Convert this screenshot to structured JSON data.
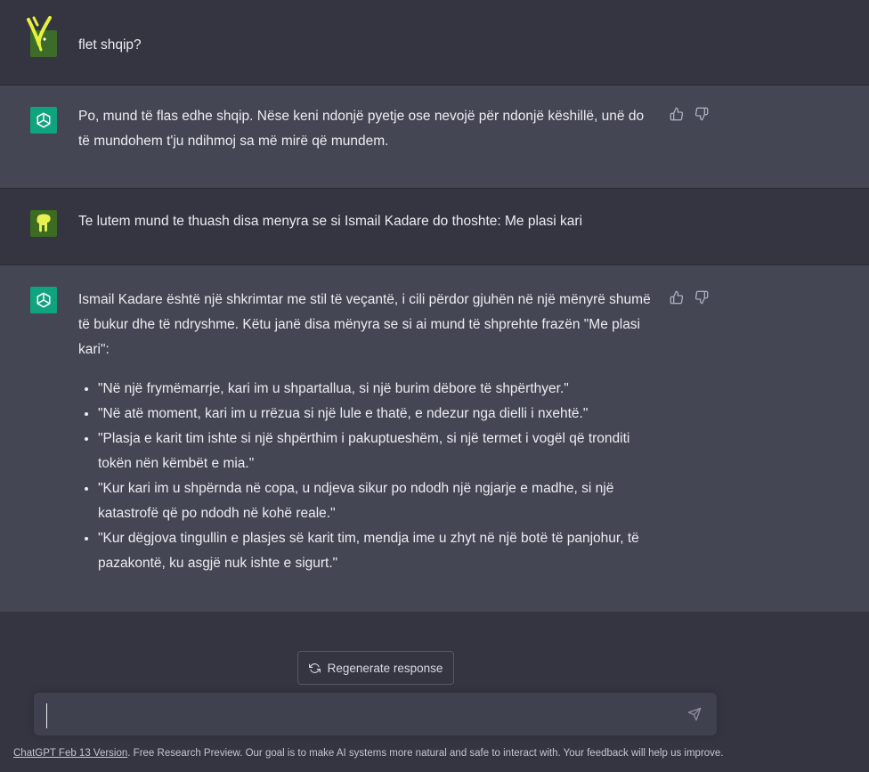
{
  "conversation": {
    "messages": [
      {
        "role": "user",
        "text": "flet shqip?"
      },
      {
        "role": "assistant",
        "text": "Po, mund të flas edhe shqip. Nëse keni ndonjë pyetje ose nevojë për ndonjë këshillë, unë do të mundohem t'ju ndihmoj sa më mirë që mundem."
      },
      {
        "role": "user",
        "text": "Te lutem mund te thuash disa menyra se si Ismail Kadare do thoshte: Me plasi kari"
      },
      {
        "role": "assistant",
        "text": "Ismail Kadare është një shkrimtar me stil të veçantë, i cili përdor gjuhën në një mënyrë shumë të bukur dhe të ndryshme. Këtu janë disa mënyra se si ai mund të shprehte frazën \"Me plasi kari\":",
        "bullets": [
          "\"Në një frymëmarrje, kari im u shpartallua, si një burim dëbore të shpërthyer.\"",
          "\"Në atë moment, kari im u rrëzua si një lule e thatë, e ndezur nga dielli i nxehtë.\"",
          "\"Plasja e karit tim ishte si një shpërthim i pakuptueshëm, si një termet i vogël që tronditi tokën nën këmbët e mia.\"",
          "\"Kur kari im u shpërnda në copa, u ndjeva sikur po ndodh një ngjarje e madhe, si një katastrofë që po ndodh në kohë reale.\"",
          "\"Kur dëgjova tingullin e plasjes së karit tim, mendja ime u zhyt në një botë të panjohur, të pazakontë, ku asgjë nuk ishte e sigurt.\""
        ]
      }
    ]
  },
  "controls": {
    "regenerate_label": "Regenerate response",
    "input_value": "",
    "icons": {
      "thumbs_up": "thumbs-up-icon",
      "thumbs_down": "thumbs-down-icon",
      "send": "send-icon",
      "regenerate": "refresh-icon"
    }
  },
  "footer": {
    "version_link": "ChatGPT Feb 13 Version",
    "disclaimer": ". Free Research Preview. Our goal is to make AI systems more natural and safe to interact with. Your feedback will help us improve."
  },
  "colors": {
    "bg": "#343541",
    "assistant_bg": "#444654",
    "assistant_avatar": "#10a37f",
    "input_bg": "#40414f"
  }
}
